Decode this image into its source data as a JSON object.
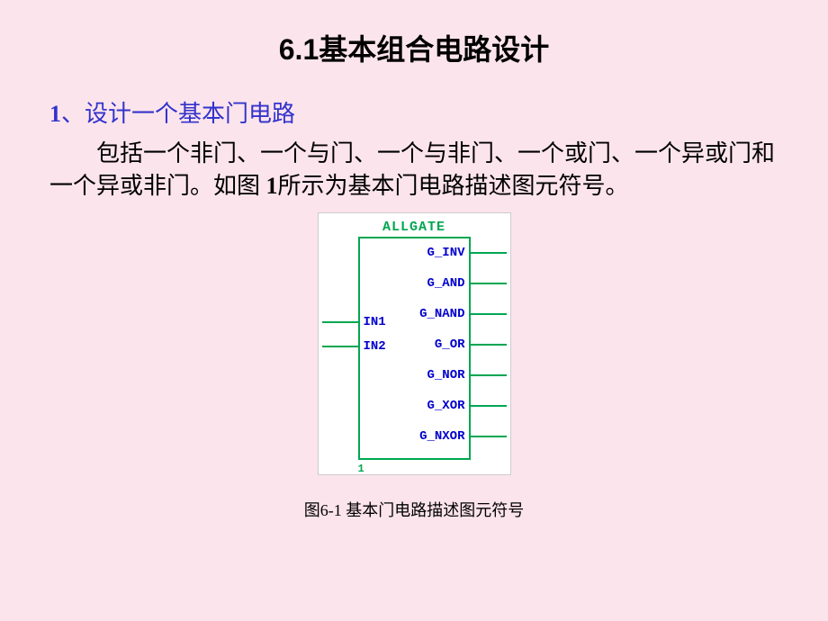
{
  "title": "6.1基本组合电路设计",
  "subtitle_num": "1",
  "subtitle_sep": "、",
  "subtitle_text": "设计一个基本门电路",
  "body_a": "包括一个非门、一个与门、一个与非门、一个或门、一个异或门和一个异或非门。如图 ",
  "body_num": "1",
  "body_b": "所示为基本门电路描述图元符号。",
  "diagram": {
    "title": "ALLGATE",
    "inputs": [
      "IN1",
      "IN2"
    ],
    "outputs": [
      "G_INV",
      "G_AND",
      "G_NAND",
      "G_OR",
      "G_NOR",
      "G_XOR",
      "G_NXOR"
    ],
    "corner": "1"
  },
  "caption": "图6-1 基本门电路描述图元符号"
}
